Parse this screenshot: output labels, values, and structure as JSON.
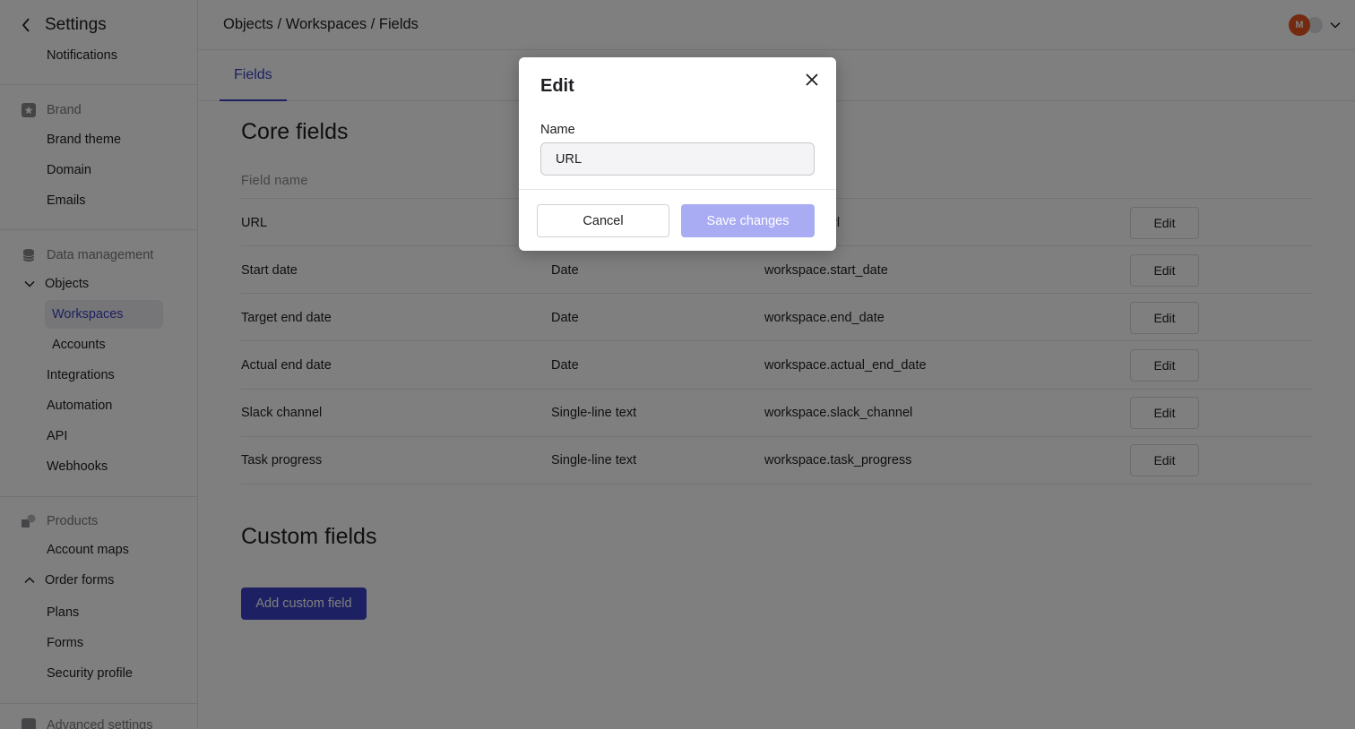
{
  "sidebar": {
    "title": "Settings",
    "top_item": "Notifications",
    "brand_section": "Brand",
    "brand_items": [
      "Brand theme",
      "Domain",
      "Emails"
    ],
    "data_section": "Data management",
    "objects_group": "Objects",
    "objects_items": [
      "Workspaces",
      "Accounts"
    ],
    "data_items": [
      "Integrations",
      "Automation",
      "API",
      "Webhooks"
    ],
    "products_section": "Products",
    "account_maps": "Account maps",
    "order_forms_group": "Order forms",
    "order_forms_items": [
      "Plans",
      "Forms",
      "Security profile"
    ],
    "advanced_section": "Advanced settings"
  },
  "header": {
    "breadcrumb": "Objects / Workspaces / Fields",
    "avatar_text": "M"
  },
  "tabs": [
    {
      "label": "Fields"
    }
  ],
  "core_fields": {
    "heading": "Core fields",
    "columns": [
      "Field name"
    ],
    "rows": [
      {
        "name": "URL",
        "type": "",
        "key": "rl",
        "action": "Edit"
      },
      {
        "name": "Start date",
        "type": "Date",
        "key": "workspace.start_date",
        "action": "Edit"
      },
      {
        "name": "Target end date",
        "type": "Date",
        "key": "workspace.end_date",
        "action": "Edit"
      },
      {
        "name": "Actual end date",
        "type": "Date",
        "key": "workspace.actual_end_date",
        "action": "Edit"
      },
      {
        "name": "Slack channel",
        "type": "Single-line text",
        "key": "workspace.slack_channel",
        "action": "Edit"
      },
      {
        "name": "Task progress",
        "type": "Single-line text",
        "key": "workspace.task_progress",
        "action": "Edit"
      }
    ]
  },
  "custom_fields": {
    "heading": "Custom fields",
    "add_button": "Add custom field"
  },
  "modal": {
    "title": "Edit",
    "name_label": "Name",
    "name_value": "URL",
    "cancel_label": "Cancel",
    "save_label": "Save changes"
  },
  "colors": {
    "accent": "#3b41c5",
    "save_disabled": "#a9acf2",
    "avatar": "#e8541e"
  }
}
